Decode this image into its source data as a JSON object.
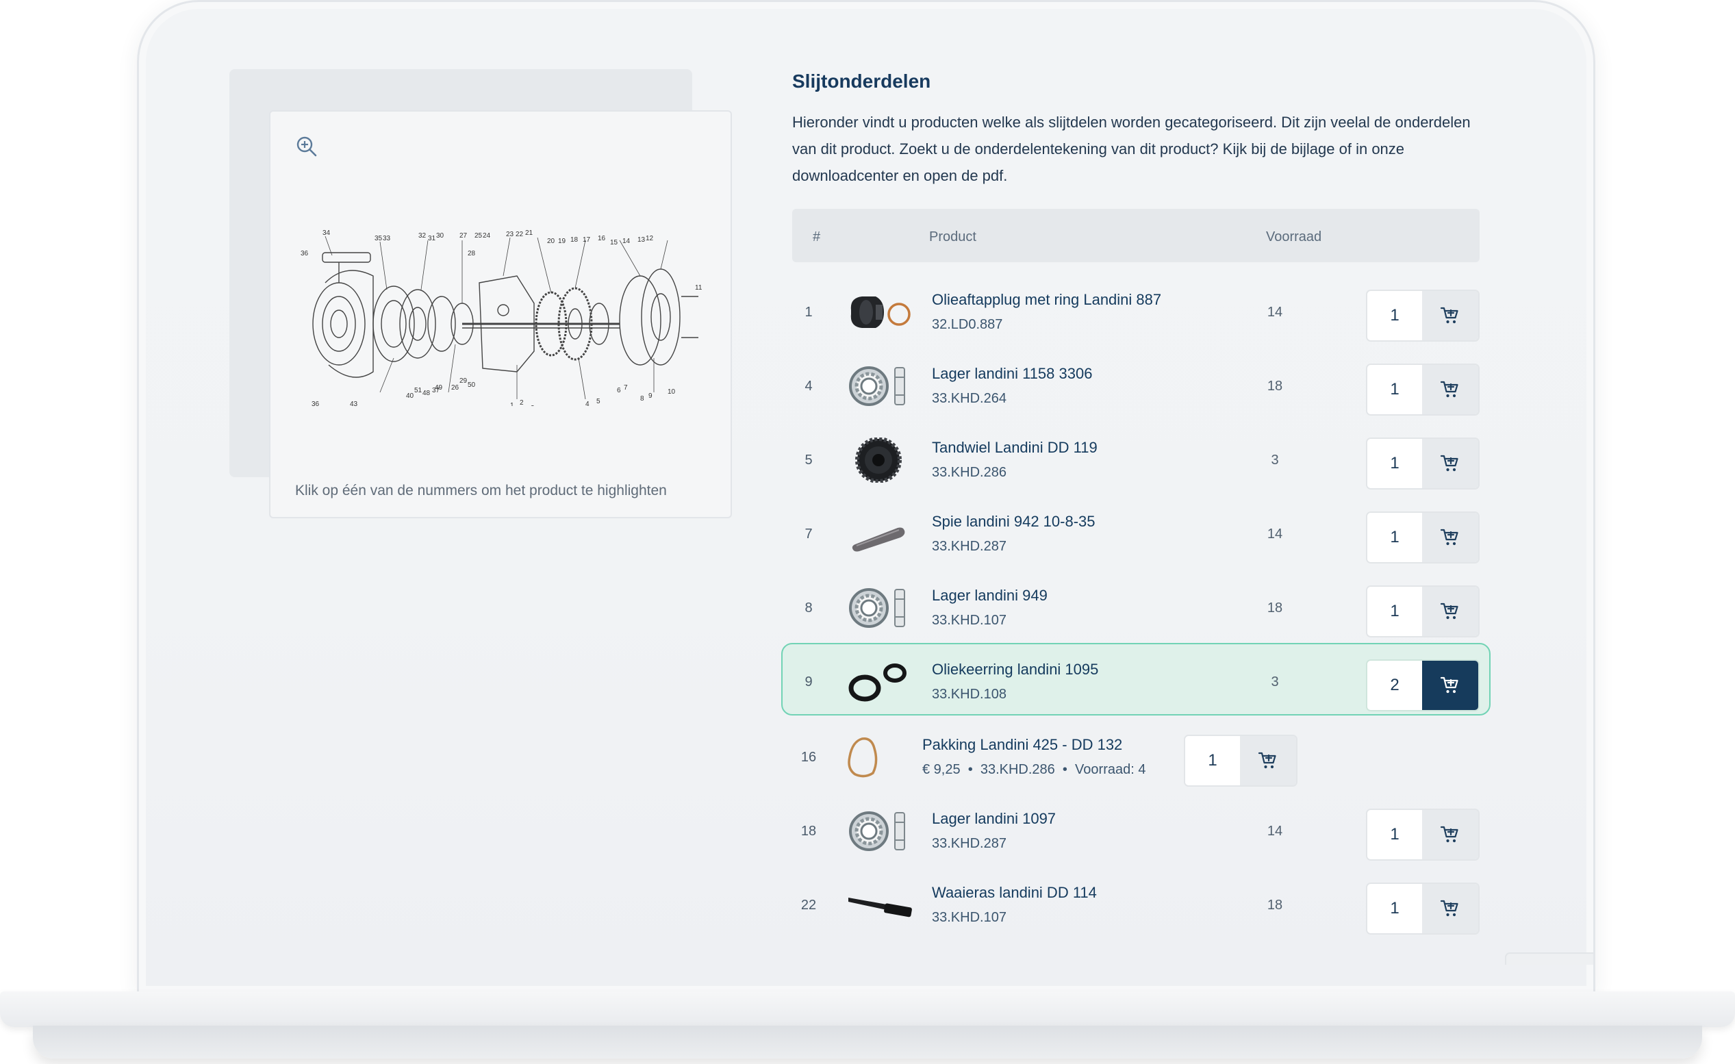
{
  "section": {
    "title": "Slijtonderdelen",
    "description": "Hieronder vindt u producten welke als slijtdelen worden gecategoriseerd. Dit zijn veelal de onderdelen van dit product. Zoekt u de onderdelentekening van dit product? Kijk bij de bijlage of in onze downloadcenter en open de pdf."
  },
  "drawing": {
    "hint": "Klik op één van de nummers om het product te highlighten",
    "numbers": [
      "34",
      "36",
      "35",
      "33",
      "32",
      "31",
      "30",
      "27",
      "25",
      "24",
      "23",
      "22",
      "21",
      "20",
      "19",
      "18",
      "17",
      "16",
      "15",
      "14",
      "13",
      "12",
      "28",
      "11",
      "29",
      "50",
      "26",
      "49",
      "51",
      "40",
      "48",
      "37",
      "43",
      "36",
      "1",
      "2",
      "3",
      "4",
      "5",
      "6",
      "7",
      "8",
      "9",
      "10"
    ]
  },
  "table": {
    "headers": {
      "num": "#",
      "product": "Product",
      "stock": "Voorraad"
    },
    "rows": [
      {
        "num": "1",
        "name": "Olieaftapplug met ring Landini 887",
        "sku": "32.LD0.887",
        "stock": "14",
        "qty": "1",
        "thumb": "plug-ring-icon"
      },
      {
        "num": "4",
        "name": "Lager landini 1158 3306",
        "sku": "33.KHD.264",
        "stock": "18",
        "qty": "1",
        "thumb": "bearing-icon"
      },
      {
        "num": "5",
        "name": "Tandwiel Landini DD 119",
        "sku": "33.KHD.286",
        "stock": "3",
        "qty": "1",
        "thumb": "gear-icon"
      },
      {
        "num": "7",
        "name": "Spie landini 942 10-8-35",
        "sku": "33.KHD.287",
        "stock": "14",
        "qty": "1",
        "thumb": "key-pin-icon"
      },
      {
        "num": "8",
        "name": "Lager landini 949",
        "sku": "33.KHD.107",
        "stock": "18",
        "qty": "1",
        "thumb": "bearing-icon"
      },
      {
        "num": "9",
        "name": "Oliekeerring landini 1095",
        "sku": "33.KHD.108",
        "stock": "3",
        "qty": "2",
        "thumb": "oil-seal-icon",
        "highlighted": true
      },
      {
        "num": "16",
        "name": "Pakking Landini 425 - DD 132",
        "price": "€ 9,25",
        "sku": "33.KHD.286",
        "stock_label": "Voorraad: 4",
        "qty": "1",
        "thumb": "gasket-icon"
      },
      {
        "num": "18",
        "name": "Lager landini 1097",
        "sku": "33.KHD.287",
        "stock": "14",
        "qty": "1",
        "thumb": "bearing-icon"
      },
      {
        "num": "22",
        "name": "Waaieras landini DD 114",
        "sku": "33.KHD.107",
        "stock": "18",
        "qty": "1",
        "thumb": "shaft-icon"
      }
    ]
  },
  "colors": {
    "accent": "#163b5c",
    "highlight_bg": "#dff1ea",
    "highlight_border": "#72d3b5"
  }
}
